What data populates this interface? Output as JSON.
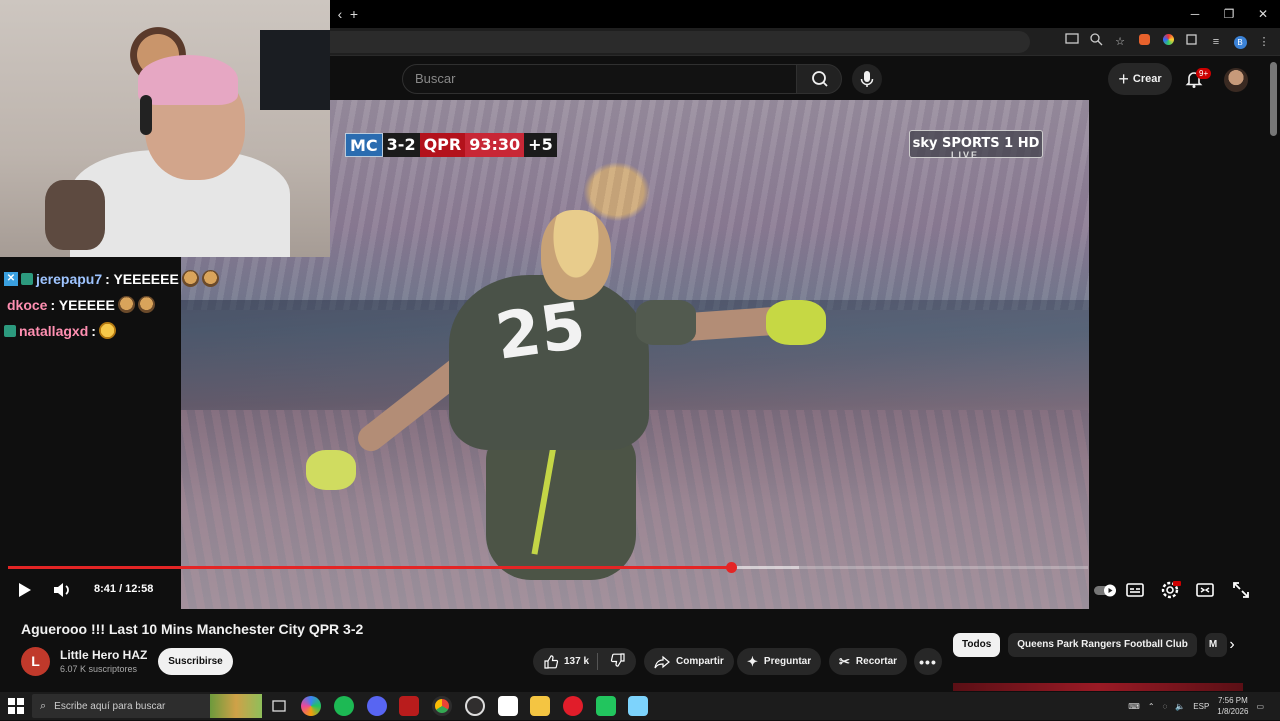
{
  "browser": {
    "tab_back_icon": "chevron-left-icon",
    "new_tab_icon": "plus-icon",
    "window_controls": [
      "minimize-icon",
      "restore-icon",
      "close-icon"
    ],
    "minimize_glyph": "─",
    "restore_glyph": "❐",
    "close_glyph": "✕",
    "toolbar_icons": [
      "cast-icon",
      "zoom-icon",
      "star-icon",
      "extension-fox-icon",
      "extension-color-icon",
      "puzzle-icon",
      "queue-icon",
      "profile-icon",
      "menu-icon"
    ]
  },
  "youtube_header": {
    "search_placeholder": "Buscar",
    "create_label": "Crear",
    "notifications_badge": "9+"
  },
  "webcam_chat": {
    "messages": [
      {
        "user": "jerepapu7",
        "text": " : YEEEEEE",
        "user_color": "#9ec4ff"
      },
      {
        "user": "dkoce",
        "text": " : YEEEEE",
        "user_color": "#ff8fb1"
      },
      {
        "user": "natallagxd",
        "text": " : ",
        "user_color": "#ff8fb1"
      }
    ]
  },
  "video_overlay": {
    "home_team": "MC",
    "score": "3-2",
    "away_team": "QPR",
    "match_time": "93:30",
    "added_time": "+5",
    "broadcaster": "sky SPORTS 1 HD",
    "broadcast_status": "LIVE",
    "jersey_number": "25"
  },
  "player": {
    "current_time": "8:41",
    "duration": "12:58",
    "time_display": "8:41 / 12:58",
    "played_fraction": 0.669,
    "buffered_fraction": 0.732
  },
  "video_info": {
    "title": "Aguerooo !!! Last 10 Mins Manchester City QPR 3-2",
    "channel_initial": "L",
    "channel_name": "Little Hero HAZ",
    "subscribers": "6.07 K suscriptores",
    "subscribe_label": "Suscribirse",
    "like_count": "137 k",
    "share_label": "Compartir",
    "ask_label": "Preguntar",
    "clip_label": "Recortar"
  },
  "chips": [
    "Todos",
    "Queens Park Rangers Football Club",
    "M"
  ],
  "taskbar": {
    "search_placeholder": "Escribe aquí para buscar",
    "language": "ESP",
    "time": "7:56 PM",
    "date": "1/8/2026"
  },
  "colors": {
    "accent_red": "#e42525",
    "background": "#0f0f0f",
    "chip_active": "#f1f1f1"
  }
}
